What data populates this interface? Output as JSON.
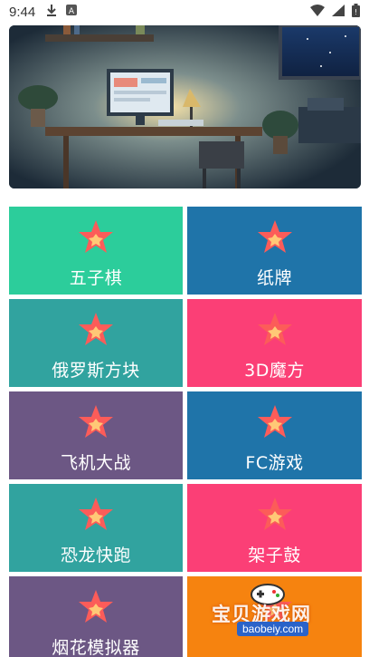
{
  "status_bar": {
    "time": "9:44",
    "icons": [
      "download-icon",
      "notification-a-icon",
      "wifi-icon",
      "signal-icon",
      "battery-icon"
    ]
  },
  "banner": {
    "image": "desk-room-night-illustration"
  },
  "tiles": [
    {
      "label": "五子棋",
      "color": "#2ccd9b"
    },
    {
      "label": "纸牌",
      "color": "#1f74a9"
    },
    {
      "label": "俄罗斯方块",
      "color": "#31a39f"
    },
    {
      "label": "3D魔方",
      "color": "#fb3f76"
    },
    {
      "label": "飞机大战",
      "color": "#6c5784"
    },
    {
      "label": "FC游戏",
      "color": "#1f74a9"
    },
    {
      "label": "恐龙快跑",
      "color": "#31a39f"
    },
    {
      "label": "架子鼓",
      "color": "#fb3f76"
    },
    {
      "label": "烟花模拟器",
      "color": "#6c5784"
    },
    {
      "label": "",
      "color": "#f6830f"
    }
  ],
  "star_colors": {
    "outer": "#fc5c59",
    "inner": "#ffc876"
  },
  "watermark": {
    "text": "宝贝游戏网",
    "url": "baobeiy.com"
  }
}
